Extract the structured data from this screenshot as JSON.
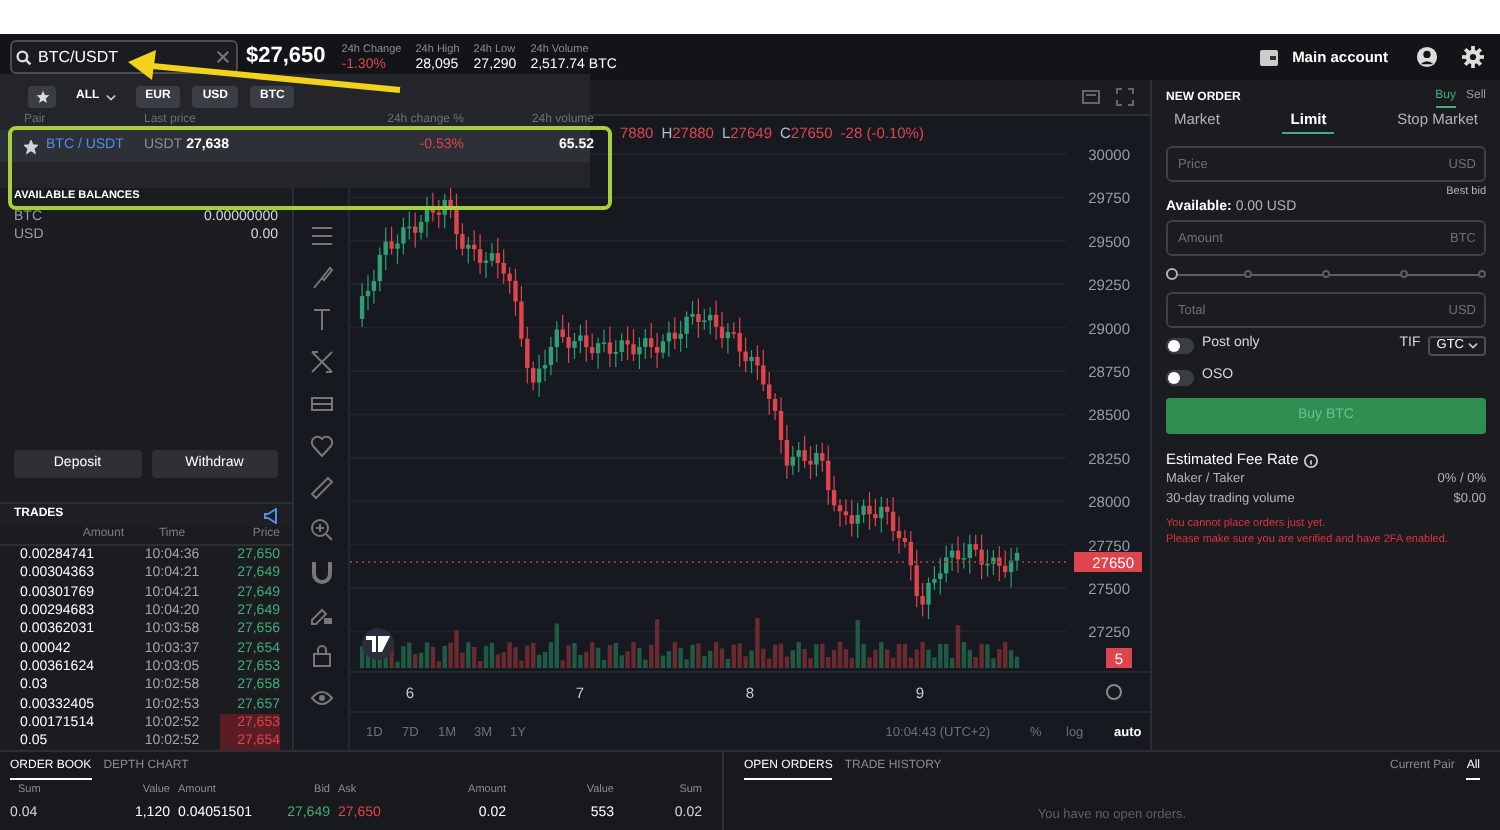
{
  "header": {
    "search": {
      "value": "BTC/USDT"
    },
    "price": "$27,650",
    "stats": [
      {
        "label": "24h Change",
        "value": "-1.30%",
        "kind": "down"
      },
      {
        "label": "24h High",
        "value": "28,095",
        "kind": "plain"
      },
      {
        "label": "24h Low",
        "value": "27,290",
        "kind": "plain"
      },
      {
        "label": "24h Volume",
        "value": "2,517.74 BTC",
        "kind": "plain"
      }
    ],
    "account": "Main account"
  },
  "market_dropdown": {
    "filters": [
      {
        "label": "ALL",
        "kind": "dropdown"
      },
      {
        "label": "EUR",
        "kind": "chip"
      },
      {
        "label": "USD",
        "kind": "chip"
      },
      {
        "label": "BTC",
        "kind": "chip"
      }
    ],
    "columns": [
      "Pair",
      "Last price",
      "24h change %",
      "24h volume"
    ],
    "rows": [
      {
        "pair": "BTC / USDT",
        "quote": "USDT",
        "price": "27,638",
        "change": "-0.53%",
        "volume": "65.52",
        "favorite": true
      }
    ]
  },
  "balances": {
    "title": "AVAILABLE BALANCES",
    "items": [
      {
        "asset": "BTC",
        "amount": "0.00000000"
      },
      {
        "asset": "USD",
        "amount": "0.00"
      }
    ]
  },
  "buttons": [
    "Deposit",
    "Withdraw"
  ],
  "trades": {
    "title": "TRADES",
    "columns": [
      "Amount",
      "Time",
      "Price"
    ],
    "rows": [
      {
        "amount": "0.00284741",
        "time": "10:04:36",
        "price": "27,650",
        "kind": "buy"
      },
      {
        "amount": "0.00304363",
        "time": "10:04:21",
        "price": "27,649",
        "kind": "buy"
      },
      {
        "amount": "0.00301769",
        "time": "10:04:21",
        "price": "27,649",
        "kind": "buy"
      },
      {
        "amount": "0.00294683",
        "time": "10:04:20",
        "price": "27,649",
        "kind": "buy"
      },
      {
        "amount": "0.00362031",
        "time": "10:03:58",
        "price": "27,656",
        "kind": "buy"
      },
      {
        "amount": "0.00042",
        "time": "10:03:37",
        "price": "27,654",
        "kind": "buy"
      },
      {
        "amount": "0.00361624",
        "time": "10:03:05",
        "price": "27,653",
        "kind": "buy"
      },
      {
        "amount": "0.03",
        "time": "10:02:58",
        "price": "27,658",
        "kind": "buy"
      },
      {
        "amount": "0.00332405",
        "time": "10:02:53",
        "price": "27,657",
        "kind": "buy"
      },
      {
        "amount": "0.00171514",
        "time": "10:02:52",
        "price": "27,653",
        "kind": "sell"
      },
      {
        "amount": "0.05",
        "time": "10:02:52",
        "price": "27,654",
        "kind": "sell"
      }
    ]
  },
  "chart": {
    "legend": [
      {
        "value": "7880"
      },
      {
        "label": "H",
        "value": "27880"
      },
      {
        "label": "L",
        "value": "27649"
      },
      {
        "label": "C",
        "value": "27650"
      },
      {
        "value": "-28 (-0.10%)"
      }
    ],
    "price_axis": [
      "30000",
      "29750",
      "29500",
      "29250",
      "29000",
      "28750",
      "28500",
      "28250",
      "28000",
      "27750",
      "27500",
      "27250"
    ],
    "last_price": "27650",
    "volume_badge": "5",
    "date_axis": [
      "6",
      "7",
      "8",
      "9"
    ],
    "timeframes": [
      "1D",
      "7D",
      "1M",
      "3M",
      "1Y"
    ],
    "clock": "10:04:43 (UTC+2)",
    "scale_options": [
      {
        "label": "%",
        "selected": false
      },
      {
        "label": "log",
        "selected": false
      },
      {
        "label": "auto",
        "selected": true
      }
    ]
  },
  "order_form": {
    "title": "NEW ORDER",
    "sides": [
      {
        "label": "Buy",
        "selected": true
      },
      {
        "label": "Sell",
        "selected": false
      }
    ],
    "types": [
      {
        "label": "Market",
        "selected": false
      },
      {
        "label": "Limit",
        "selected": true
      },
      {
        "label": "Stop Market",
        "selected": false
      }
    ],
    "price_field": {
      "placeholder": "Price",
      "unit": "USD"
    },
    "best_bid": "Best bid",
    "available_label": "Available:",
    "available_value": "0.00 USD",
    "amount_field": {
      "placeholder": "Amount",
      "unit": "BTC"
    },
    "slider": {
      "level": 0
    },
    "total_field": {
      "placeholder": "Total",
      "unit": "USD"
    },
    "toggles": [
      {
        "label": "Post only",
        "on": false
      },
      {
        "label": "OSO",
        "on": false
      }
    ],
    "tif": {
      "label": "TIF",
      "value": "GTC"
    },
    "submit": {
      "label": "Buy BTC",
      "disabled": true
    },
    "fee": {
      "title": "Estimated Fee Rate",
      "rows": [
        {
          "label": "Maker / Taker",
          "value": "0% / 0%"
        },
        {
          "label": "30-day trading volume",
          "value": "$0.00"
        }
      ]
    },
    "warnings": [
      "You cannot place orders just yet.",
      "Please make sure you are verified and have 2FA enabled."
    ]
  },
  "order_book": {
    "tabs": [
      {
        "label": "ORDER BOOK",
        "selected": true
      },
      {
        "label": "DEPTH CHART",
        "selected": false
      }
    ],
    "columns": [
      "Sum",
      "Value",
      "Amount",
      "Bid",
      "Ask",
      "Amount",
      "Value",
      "Sum"
    ],
    "rows": [
      [
        "0.04",
        "1,120",
        "0.04051501",
        "27,649",
        "27,650",
        "0.02",
        "553",
        "0.02"
      ]
    ]
  },
  "orders": {
    "tabs": [
      {
        "label": "OPEN ORDERS",
        "selected": true
      },
      {
        "label": "TRADE HISTORY",
        "selected": false
      }
    ],
    "filters": [
      {
        "label": "Current Pair",
        "selected": false
      },
      {
        "label": "All",
        "selected": true
      }
    ],
    "empty_text": "You have no open orders."
  }
}
